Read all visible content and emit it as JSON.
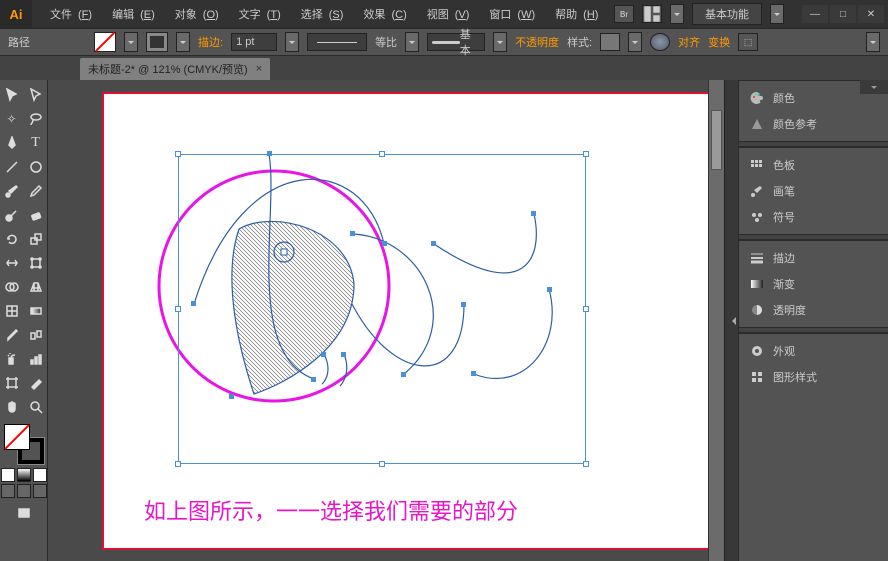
{
  "app": {
    "logo": "Ai"
  },
  "menu": {
    "file": {
      "label": "文件",
      "key": "F"
    },
    "edit": {
      "label": "编辑",
      "key": "E"
    },
    "object": {
      "label": "对象",
      "key": "O"
    },
    "type": {
      "label": "文字",
      "key": "T"
    },
    "select": {
      "label": "选择",
      "key": "S"
    },
    "effect": {
      "label": "效果",
      "key": "C"
    },
    "view": {
      "label": "视图",
      "key": "V"
    },
    "window": {
      "label": "窗口",
      "key": "W"
    },
    "help": {
      "label": "帮助",
      "key": "H"
    }
  },
  "workspace": {
    "label": "基本功能"
  },
  "options": {
    "selection_label": "路径",
    "stroke_label": "描边:",
    "stroke_value": "1 pt",
    "dash_label": "等比",
    "profile_label": "基本",
    "opacity_label": "不透明度",
    "style_label": "样式:",
    "align_label": "对齐",
    "transform_label": "变换"
  },
  "tab": {
    "title": "未标题-2* @ 121% (CMYK/预览)",
    "close": "×"
  },
  "panels": {
    "color": "颜色",
    "color_guide": "颜色参考",
    "swatches": "色板",
    "brushes": "画笔",
    "symbols": "符号",
    "stroke": "描边",
    "gradient": "渐变",
    "transparency": "透明度",
    "appearance": "外观",
    "graphic_styles": "图形样式"
  },
  "canvas": {
    "caption": "如上图所示，一一选择我们需要的部分"
  }
}
